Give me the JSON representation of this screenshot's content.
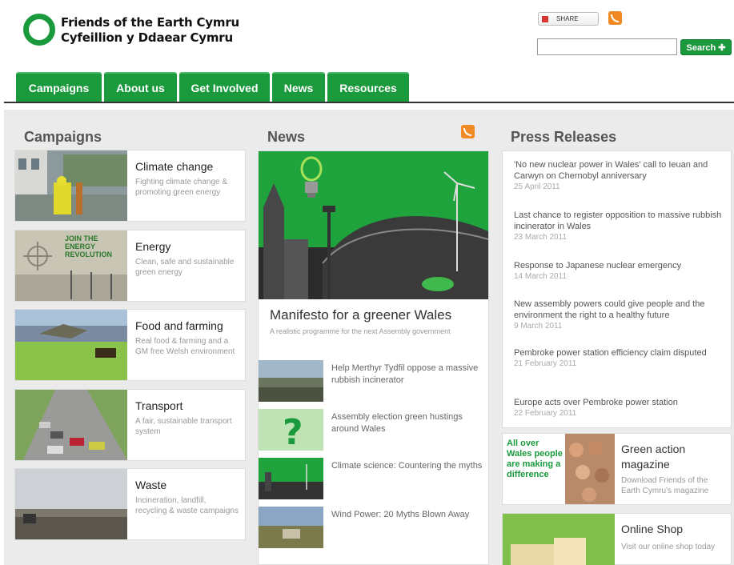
{
  "header": {
    "logo_line1": "Friends of the Earth Cymru",
    "logo_line2": "Cyfeillion y Ddaear Cymru",
    "share_label": "SHARE",
    "search_placeholder": "",
    "search_button": "Search ✚"
  },
  "nav": {
    "tabs": [
      {
        "label": "Campaigns"
      },
      {
        "label": "About us"
      },
      {
        "label": "Get Involved"
      },
      {
        "label": "News"
      },
      {
        "label": "Resources"
      }
    ]
  },
  "campaigns": {
    "heading": "Campaigns",
    "items": [
      {
        "title": "Climate change",
        "desc": "Fighting climate change & promoting green energy"
      },
      {
        "title": "Energy",
        "desc": "Clean, safe and sustainable green energy"
      },
      {
        "title": "Food and farming",
        "desc": "Real food & farming and a GM free Welsh environment"
      },
      {
        "title": "Transport",
        "desc": "A fair, sustainable transport system"
      },
      {
        "title": "Waste",
        "desc": "Incineration, landfill, recycling & waste campaigns"
      }
    ],
    "energy_banner": "JOIN THE ENERGY REVOLUTION"
  },
  "news": {
    "heading": "News",
    "headline": "Manifesto for a greener Wales",
    "subheadline": "A realistic programme for the next Assembly government",
    "items": [
      {
        "title": "Help Merthyr Tydfil oppose a massive rubbish incinerator"
      },
      {
        "title": "Assembly election green hustings around Wales"
      },
      {
        "title": "Climate science: Countering the myths"
      },
      {
        "title": "Wind Power: 20 Myths Blown Away"
      }
    ]
  },
  "press": {
    "heading": "Press Releases",
    "items": [
      {
        "title": "'No new nuclear power in Wales' call to Ieuan and Carwyn on Chernobyl anniversary",
        "date": "25 April 2011"
      },
      {
        "title": "Last chance to register opposition to massive rubbish incinerator in Wales",
        "date": "23 March 2011"
      },
      {
        "title": "Response to Japanese nuclear emergency",
        "date": "14 March 2011"
      },
      {
        "title": "New assembly powers could give people and the environment the right to a healthy future",
        "date": "9 March 2011"
      },
      {
        "title": "Pembroke power station efficiency claim disputed",
        "date": "21 February 2011"
      },
      {
        "title": "Europe acts over Pembroke power station",
        "date": "22 February 2011"
      }
    ]
  },
  "promos": {
    "magazine_title": "Green action magazine",
    "magazine_desc": "Download Friends of the Earth Cymru's magazine",
    "magazine_banner": "All over Wales people are making a difference",
    "shop_title": "Online Shop",
    "shop_desc": "Visit our online shop today"
  },
  "colors": {
    "brand_green": "#1a9a3c",
    "rss_orange": "#f08a24"
  }
}
